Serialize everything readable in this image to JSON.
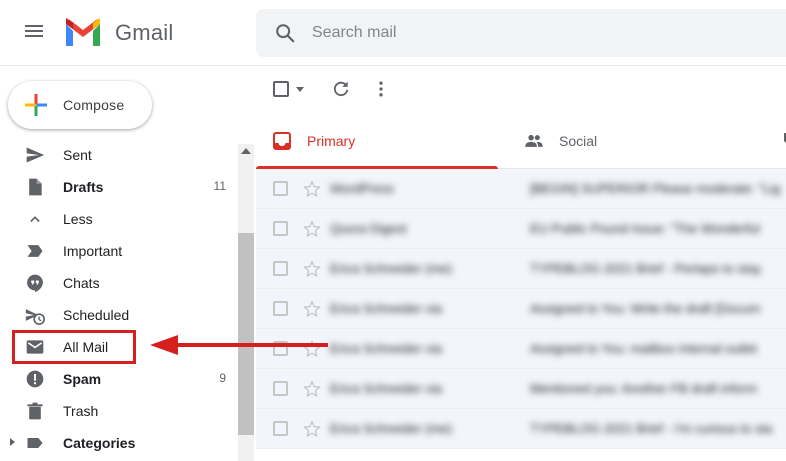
{
  "header": {
    "app_name": "Gmail",
    "search_placeholder": "Search mail"
  },
  "compose": {
    "label": "Compose"
  },
  "sidebar": {
    "items": [
      {
        "label": "Sent",
        "count": ""
      },
      {
        "label": "Drafts",
        "count": "11"
      },
      {
        "label": "Less",
        "count": ""
      },
      {
        "label": "Important",
        "count": ""
      },
      {
        "label": "Chats",
        "count": ""
      },
      {
        "label": "Scheduled",
        "count": ""
      },
      {
        "label": "All Mail",
        "count": ""
      },
      {
        "label": "Spam",
        "count": "9"
      },
      {
        "label": "Trash",
        "count": ""
      },
      {
        "label": "Categories",
        "count": ""
      }
    ]
  },
  "tabs": [
    {
      "label": "Primary",
      "active": true
    },
    {
      "label": "Social",
      "active": false
    }
  ],
  "emails": [
    {
      "sender": "WordPress",
      "subject": "[BEGIN] SUPERIOR Please moderate: \"Lig"
    },
    {
      "sender": "Quora Digest",
      "subject": "EU Public Pound Issue: \"The Wonderful"
    },
    {
      "sender": "Erica Schneider (me)",
      "subject": "TYPEBLOG 2021 Brief - Pertaps to stay"
    },
    {
      "sender": "Erica Schneider via",
      "subject": "Assigned to You: Write the draft [Docum"
    },
    {
      "sender": "Erica Schneider via",
      "subject": "Assigned to You: mailbox internal outlet"
    },
    {
      "sender": "Erica Schneider via",
      "subject": "Mentioned you: Another FB draft inform"
    },
    {
      "sender": "Erica Schneider (me)",
      "subject": "TYPEBLOG 2021 Brief - I'm curious to sta"
    }
  ],
  "colors": {
    "highlight": "#d61f1f",
    "primary_tab": "#d93025"
  }
}
